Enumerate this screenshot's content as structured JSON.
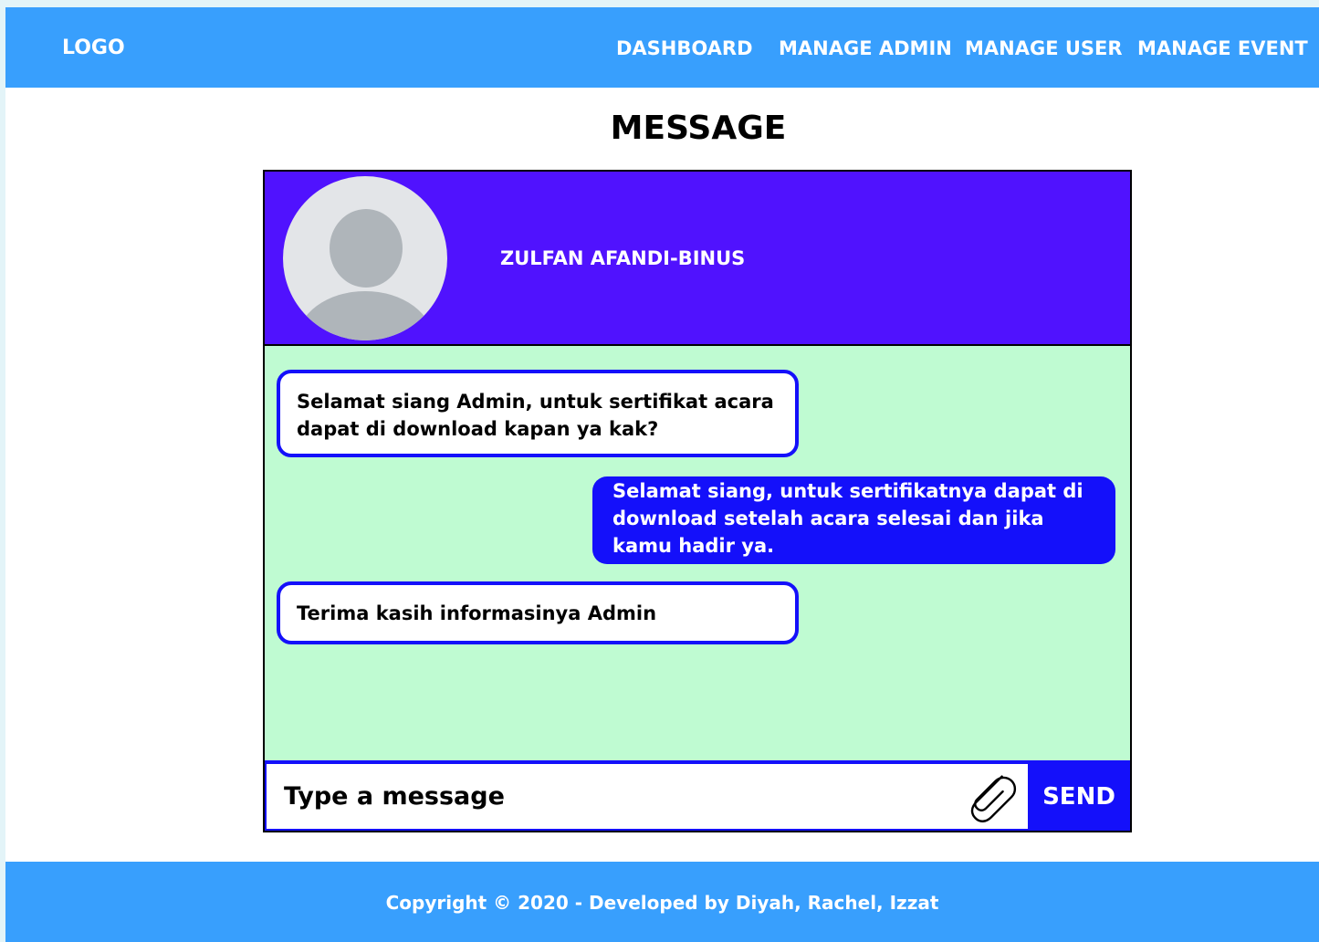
{
  "navbar": {
    "logo": "LOGO",
    "links": [
      "DASHBOARD",
      "MANAGE ADMIN",
      "MANAGE USER",
      "MANAGE EVENT"
    ]
  },
  "page": {
    "title": "MESSAGE"
  },
  "chat": {
    "contact_name": "ZULFAN AFANDI-BINUS",
    "messages": [
      {
        "direction": "incoming",
        "text": "Selamat siang Admin, untuk sertifikat acara dapat di download kapan ya kak?"
      },
      {
        "direction": "outgoing",
        "text": "Selamat siang, untuk sertifikatnya dapat di download setelah acara selesai dan jika kamu hadir ya."
      },
      {
        "direction": "incoming",
        "text": "Terima kasih informasinya Admin"
      }
    ],
    "composer": {
      "placeholder": "Type a message",
      "attach_icon": "paperclip-icon",
      "send_label": "SEND"
    }
  },
  "footer": {
    "copyright": "Copyright © 2020 - Developed by Diyah, Rachel, Izzat"
  },
  "colors": {
    "nav_footer_bg": "#389ffd",
    "header_purple": "#5012fe",
    "chat_bg": "#bffbd2",
    "accent_blue": "#1410fa"
  }
}
